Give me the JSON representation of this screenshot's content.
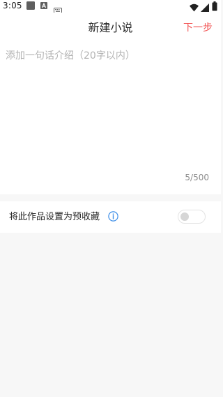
{
  "status_bar": {
    "time": "3:05",
    "icons": [
      "app-notification-icon",
      "a-notification-icon",
      "keyboard-icon",
      "wifi-icon",
      "cell-signal-icon",
      "battery-icon"
    ]
  },
  "header": {
    "title": "新建小说",
    "next_label": "下一步"
  },
  "intro": {
    "placeholder": "添加一句话介绍（20字以内）",
    "value": "",
    "counter": "5/500"
  },
  "settings": {
    "pre_collection_label": "将此作品设置为预收藏",
    "pre_collection_enabled": false
  },
  "colors": {
    "accent": "#f25353",
    "background": "#f7f7f7",
    "panel": "#ffffff",
    "info": "#3d8ee8"
  }
}
